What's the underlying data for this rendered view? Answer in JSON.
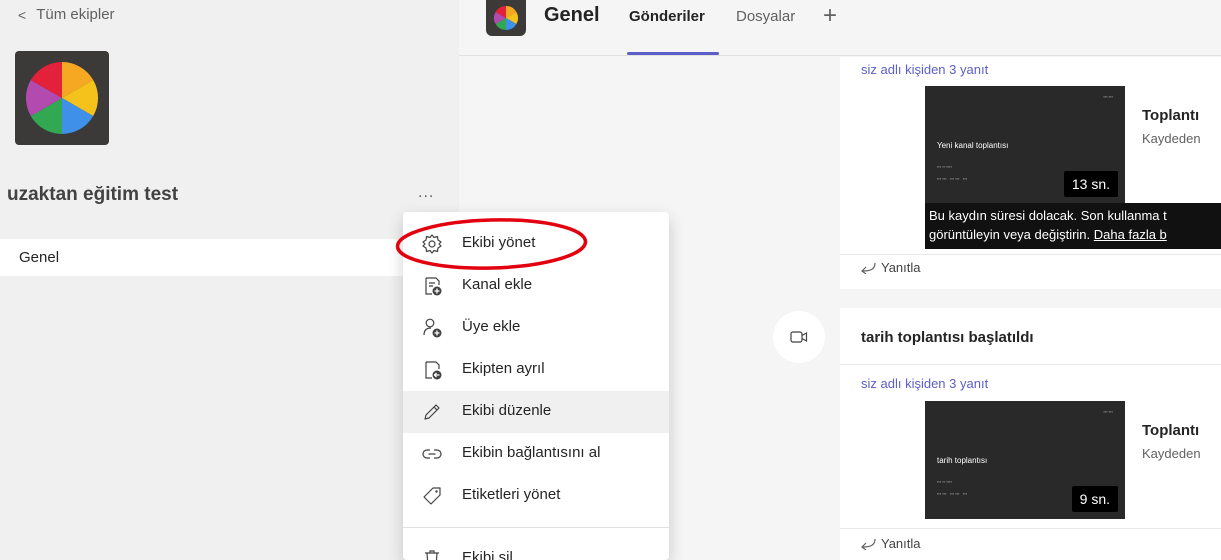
{
  "sidebar": {
    "back_label": "Tüm ekipler",
    "team_name": "uzaktan eğitim test",
    "more_label": "...",
    "channels": [
      {
        "label": "Genel"
      }
    ]
  },
  "header": {
    "channel_title": "Genel",
    "tabs": [
      {
        "label": "Gönderiler",
        "active": true
      },
      {
        "label": "Dosyalar",
        "active": false
      }
    ],
    "add_tab_label": "+"
  },
  "menu": {
    "items": [
      {
        "label": "Ekibi yönet",
        "icon": "gear-icon"
      },
      {
        "label": "Kanal ekle",
        "icon": "add-channel-icon"
      },
      {
        "label": "Üye ekle",
        "icon": "add-member-icon"
      },
      {
        "label": "Ekipten ayrıl",
        "icon": "leave-team-icon"
      },
      {
        "label": "Ekibi düzenle",
        "icon": "pencil-icon",
        "hover": true
      },
      {
        "label": "Ekibin bağlantısını al",
        "icon": "link-icon"
      },
      {
        "label": "Etiketleri yönet",
        "icon": "tag-icon"
      },
      {
        "label": "Ekibi sil",
        "icon": "trash-icon"
      }
    ],
    "highlight_color": "#e3000f"
  },
  "posts": [
    {
      "reply_count_text": "siz adlı kişiden 3 yanıt",
      "thumbnail_label": "Yeni kanal toplantısı",
      "duration": "13 sn.",
      "recording_title": "Toplantı",
      "recording_sub": "Kaydeden",
      "warning_line1": "Bu kaydın süresi dolacak. Son kullanma t",
      "warning_line2": "görüntüleyin veya değiştirin.",
      "warning_link": "Daha fazla b",
      "reply_label": "Yanıtla"
    },
    {
      "meeting_started": "tarih toplantısı başlatıldı",
      "reply_count_text": "siz adlı kişiden 3 yanıt",
      "thumbnail_label": "tarih toplantısı",
      "duration": "9 sn.",
      "recording_title": "Toplantı",
      "recording_sub": "Kaydeden",
      "reply_label": "Yanıtla"
    }
  ],
  "colors": {
    "accent": "#5b5fc7",
    "logo_bg": "#3b3a39"
  }
}
